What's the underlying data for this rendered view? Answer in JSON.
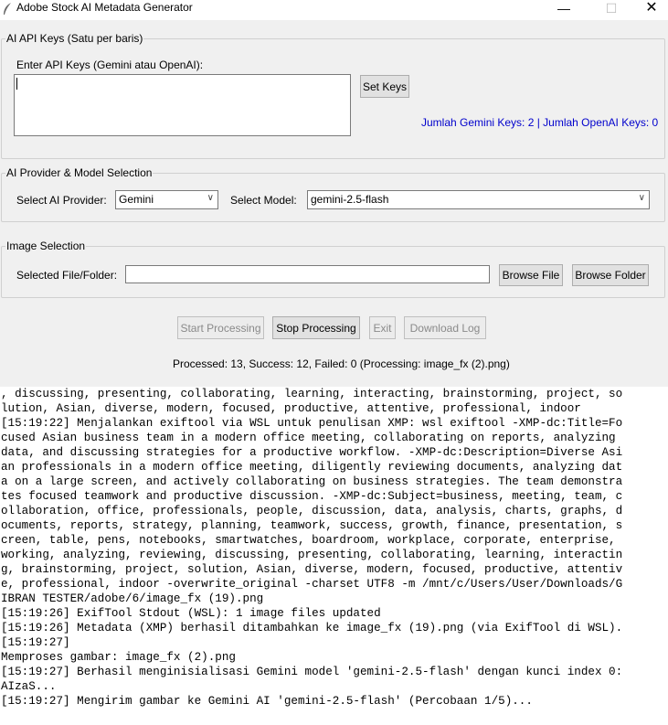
{
  "window": {
    "title": "Adobe Stock AI Metadata Generator",
    "minimize": "—",
    "maximize": "☐",
    "close": "✕"
  },
  "api_keys": {
    "legend": "AI API Keys (Satu per baris)",
    "label": "Enter API Keys (Gemini atau OpenAI):",
    "set_button": "Set Keys",
    "status": "Jumlah Gemini Keys: 2 | Jumlah OpenAI Keys: 0",
    "status_color": "#0000cc"
  },
  "provider": {
    "legend": "AI Provider & Model Selection",
    "provider_label": "Select AI Provider:",
    "provider_value": "Gemini",
    "model_label": "Select Model:",
    "model_value": "gemini-2.5-flash"
  },
  "image": {
    "legend": "Image Selection",
    "label": "Selected File/Folder:",
    "value": "",
    "browse_file": "Browse File",
    "browse_folder": "Browse Folder"
  },
  "actions": {
    "start": "Start Processing",
    "stop": "Stop Processing",
    "exit": "Exit",
    "download": "Download Log"
  },
  "progress": "Processed: 13, Success: 12, Failed: 0 (Processing: image_fx (2).png)",
  "log_lines": [
    ", discussing, presenting, collaborating, learning, interacting, brainstorming, project, so",
    "lution, Asian, diverse, modern, focused, productive, attentive, professional, indoor",
    "[15:19:22] Menjalankan exiftool via WSL untuk penulisan XMP: wsl exiftool -XMP-dc:Title=Fo",
    "cused Asian business team in a modern office meeting, collaborating on reports, analyzing",
    "data, and discussing strategies for a productive workflow. -XMP-dc:Description=Diverse Asi",
    "an professionals in a modern office meeting, diligently reviewing documents, analyzing dat",
    "a on a large screen, and actively collaborating on business strategies. The team demonstra",
    "tes focused teamwork and productive discussion. -XMP-dc:Subject=business, meeting, team, c",
    "ollaboration, office, professionals, people, discussion, data, analysis, charts, graphs, d",
    "ocuments, reports, strategy, planning, teamwork, success, growth, finance, presentation, s",
    "creen, table, pens, notebooks, smartwatches, boardroom, workplace, corporate, enterprise,",
    "working, analyzing, reviewing, discussing, presenting, collaborating, learning, interactin",
    "g, brainstorming, project, solution, Asian, diverse, modern, focused, productive, attentiv",
    "e, professional, indoor -overwrite_original -charset UTF8 -m /mnt/c/Users/User/Downloads/G",
    "IBRAN TESTER/adobe/6/image_fx (19).png",
    "[15:19:26] ExifTool Stdout (WSL): 1 image files updated",
    "[15:19:26] Metadata (XMP) berhasil ditambahkan ke image_fx (19).png (via ExifTool di WSL).",
    "[15:19:27]",
    "Memproses gambar: image_fx (2).png",
    "[15:19:27] Berhasil menginisialisasi Gemini model 'gemini-2.5-flash' dengan kunci index 0:",
    "AIzaS...",
    "[15:19:27] Mengirim gambar ke Gemini AI 'gemini-2.5-flash' (Percobaan 1/5)..."
  ]
}
